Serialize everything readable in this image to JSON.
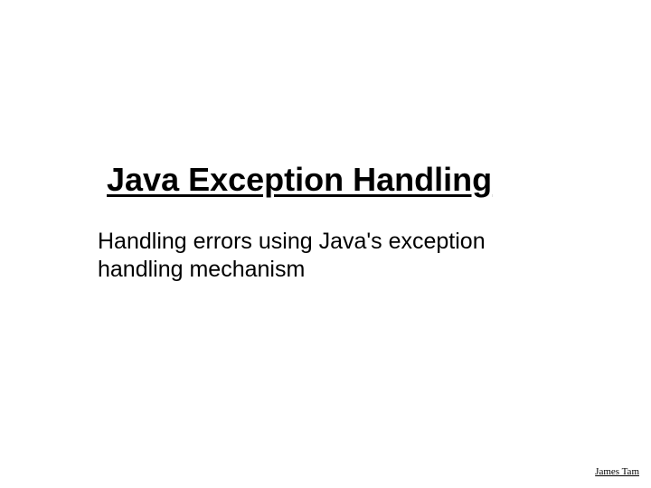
{
  "slide": {
    "title": "Java Exception Handling",
    "subtitle": "Handling errors using Java's exception handling mechanism",
    "author": "James Tam"
  }
}
